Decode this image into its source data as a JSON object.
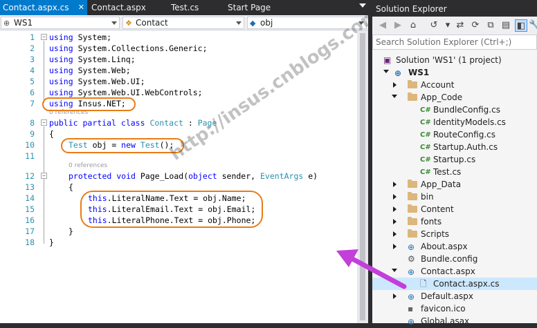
{
  "editor": {
    "tabs": [
      {
        "label": "Contact.aspx.cs",
        "active": true,
        "close": "✕"
      },
      {
        "label": "Contact.aspx"
      },
      {
        "label": "Test.cs"
      },
      {
        "label": "Start Page"
      }
    ],
    "nav": {
      "project": "WS1",
      "class": "Contact",
      "member": "obj"
    },
    "line_numbers": [
      "1",
      "2",
      "3",
      "4",
      "5",
      "6",
      "7",
      "8",
      "9",
      "10",
      "11",
      "12",
      "13",
      "14",
      "15",
      "16",
      "17",
      "18"
    ],
    "codelens": [
      "0 references",
      "0 references"
    ],
    "code": {
      "l1": "System;",
      "l2": "System.Collections.Generic;",
      "l3": "System.Linq;",
      "l4": "System.Web;",
      "l5": "System.Web.UI;",
      "l6": "System.Web.UI.WebControls;",
      "l7": "Insus.NET;",
      "kw_using": "using",
      "kw_public": "public",
      "kw_partial": "partial",
      "kw_class": "class",
      "class_name": "Contact",
      "colon": " : ",
      "base_type": "Page",
      "brace_open": "{",
      "brace_close": "}",
      "t_test": "Test",
      "obj_decl": " obj = ",
      "kw_new": "new",
      "ctor": "Test",
      "ctor_tail": "();",
      "kw_protected": "protected",
      "kw_void": "void",
      "method": " Page_Load(",
      "kw_object": "object",
      "sender": " sender, ",
      "t_eventargs": "EventArgs",
      "e_tail": " e)",
      "kw_this": "this",
      "s14": ".LiteralName.Text = obj.Name;",
      "s15": ".LiteralEmail.Text = obj.Email;",
      "s16": ".LiteralPhone.Text = obj.Phone;"
    },
    "watermark": "http://insus.cnblogs.com"
  },
  "solution_explorer": {
    "title": "Solution Explorer",
    "search_placeholder": "Search Solution Explorer (Ctrl+;)",
    "solution": "Solution 'WS1' (1 project)",
    "project": "WS1",
    "items": [
      {
        "label": "Account",
        "kind": "folder",
        "state": "closed"
      },
      {
        "label": "App_Code",
        "kind": "folder",
        "state": "open"
      },
      {
        "label": "BundleConfig.cs",
        "kind": "cs"
      },
      {
        "label": "IdentityModels.cs",
        "kind": "cs"
      },
      {
        "label": "RouteConfig.cs",
        "kind": "cs"
      },
      {
        "label": "Startup.Auth.cs",
        "kind": "cs"
      },
      {
        "label": "Startup.cs",
        "kind": "cs"
      },
      {
        "label": "Test.cs",
        "kind": "cs"
      },
      {
        "label": "App_Data",
        "kind": "folder",
        "state": "closed"
      },
      {
        "label": "bin",
        "kind": "folder",
        "state": "closed"
      },
      {
        "label": "Content",
        "kind": "folder",
        "state": "closed"
      },
      {
        "label": "fonts",
        "kind": "folder",
        "state": "closed"
      },
      {
        "label": "Scripts",
        "kind": "folder",
        "state": "closed"
      },
      {
        "label": "About.aspx",
        "kind": "web",
        "state": "closed"
      },
      {
        "label": "Bundle.config",
        "kind": "config"
      },
      {
        "label": "Contact.aspx",
        "kind": "web",
        "state": "open"
      },
      {
        "label": "Contact.aspx.cs",
        "kind": "page",
        "selected": true
      },
      {
        "label": "Default.aspx",
        "kind": "web",
        "state": "closed"
      },
      {
        "label": "favicon.ico",
        "kind": "ico"
      },
      {
        "label": "Global.asax",
        "kind": "web"
      }
    ]
  },
  "colors": {
    "accent": "#007acc",
    "highlight_ring": "#e87c16",
    "arrow": "#c23fd9"
  }
}
